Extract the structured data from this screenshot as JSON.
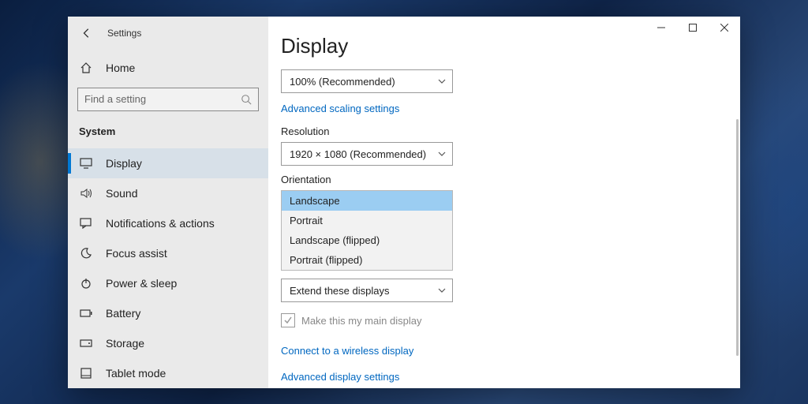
{
  "titlebar": {
    "app_name": "Settings"
  },
  "sidebar": {
    "home_label": "Home",
    "search_placeholder": "Find a setting",
    "category": "System",
    "items": [
      {
        "label": "Display"
      },
      {
        "label": "Sound"
      },
      {
        "label": "Notifications & actions"
      },
      {
        "label": "Focus assist"
      },
      {
        "label": "Power & sleep"
      },
      {
        "label": "Battery"
      },
      {
        "label": "Storage"
      },
      {
        "label": "Tablet mode"
      }
    ]
  },
  "main": {
    "title": "Display",
    "scale": {
      "value": "100% (Recommended)"
    },
    "advanced_scaling_link": "Advanced scaling settings",
    "resolution": {
      "label": "Resolution",
      "value": "1920 × 1080 (Recommended)"
    },
    "orientation": {
      "label": "Orientation",
      "options": [
        "Landscape",
        "Portrait",
        "Landscape (flipped)",
        "Portrait (flipped)"
      ],
      "selected": "Landscape"
    },
    "multidisplay": {
      "value": "Extend these displays"
    },
    "main_display_checkbox": {
      "label": "Make this my main display",
      "checked": true
    },
    "wireless_link": "Connect to a wireless display",
    "advanced_display_link": "Advanced display settings"
  }
}
